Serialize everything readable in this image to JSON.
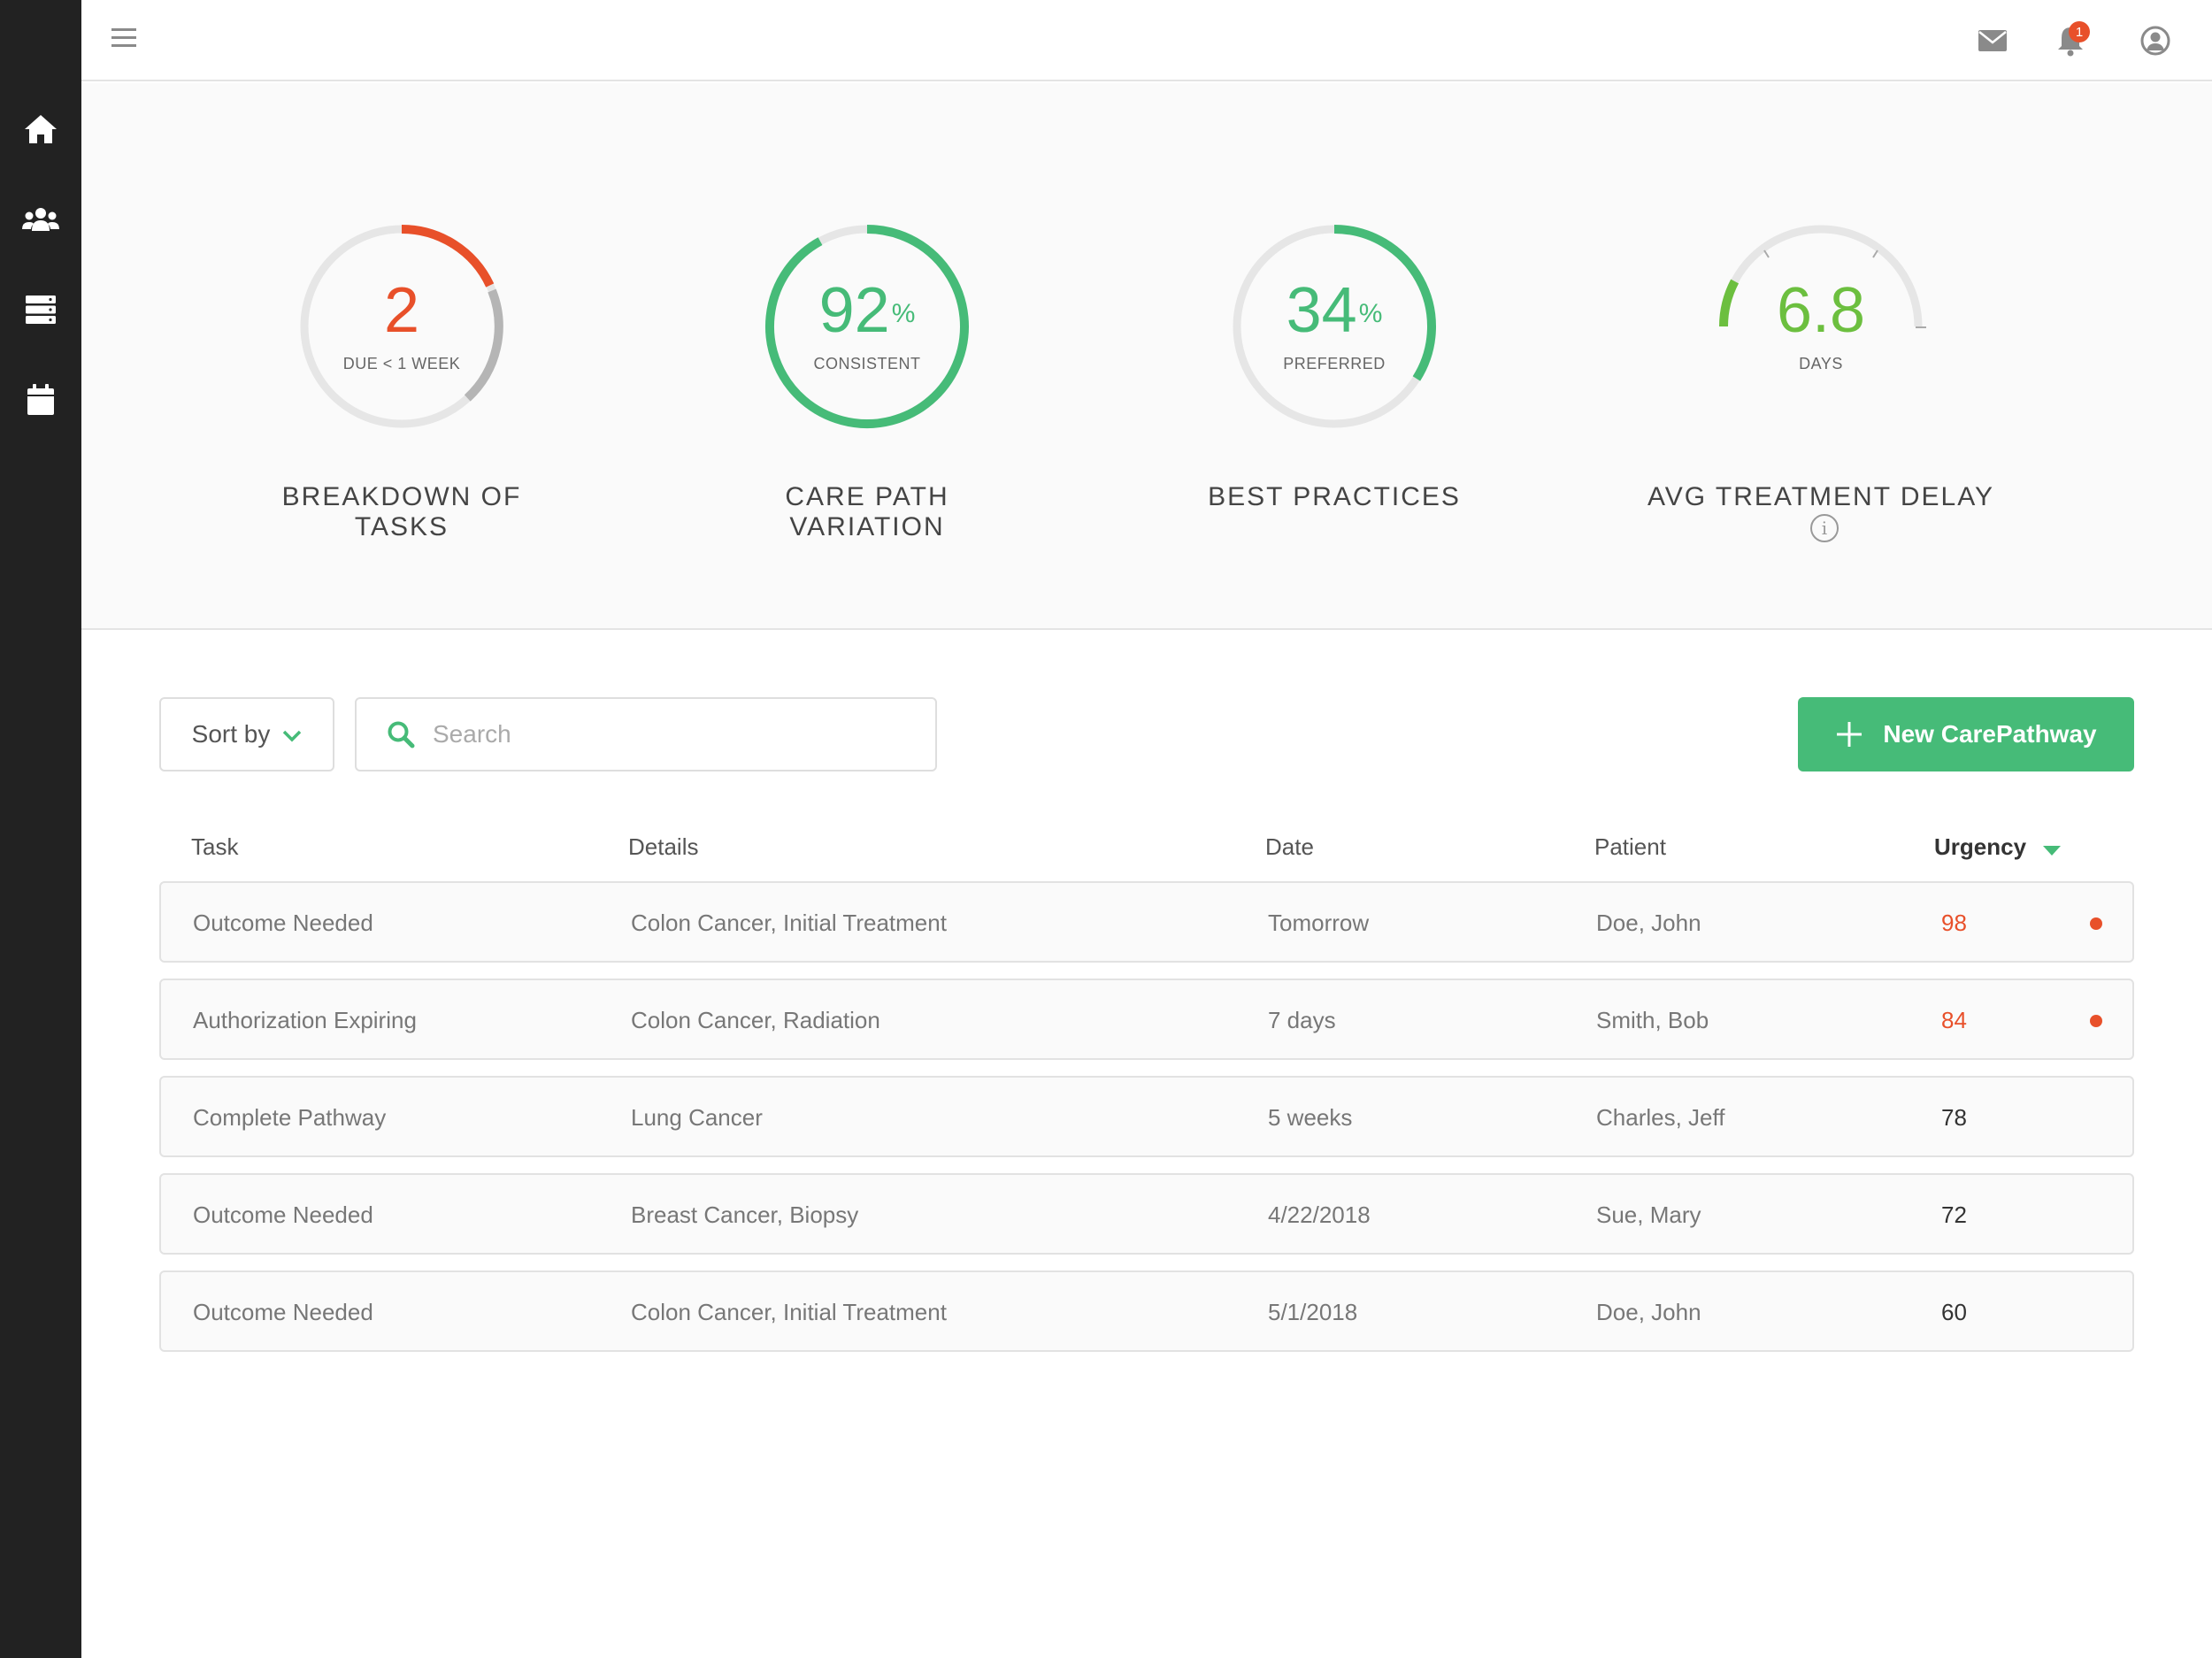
{
  "sidebar": {
    "items": [
      {
        "icon": "home-icon"
      },
      {
        "icon": "users-icon"
      },
      {
        "icon": "server-icon"
      },
      {
        "icon": "calendar-icon"
      }
    ]
  },
  "topbar": {
    "menu_icon": "menu-icon",
    "notification_count": "1",
    "icons": [
      "mail-icon",
      "bell-icon",
      "user-icon"
    ]
  },
  "metrics": [
    {
      "value": "2",
      "unit": "",
      "sub": "DUE < 1 WEEK",
      "title": "BREAKDOWN OF TASKS",
      "color": "#e8502a"
    },
    {
      "value": "92",
      "unit": "%",
      "sub": "CONSISTENT",
      "title": "CARE PATH VARIATION",
      "color": "#46bb78",
      "fraction": 0.92
    },
    {
      "value": "34",
      "unit": "%",
      "sub": "PREFERRED",
      "title": "BEST PRACTICES",
      "color": "#46bb78",
      "fraction": 0.34
    },
    {
      "value": "6.8",
      "unit": "",
      "sub": "DAYS",
      "title": "AVG TREATMENT DELAY",
      "color": "#6cbf3f",
      "info": "i"
    }
  ],
  "controls": {
    "sort_label": "Sort by",
    "search_placeholder": "Search",
    "new_button_label": "New CarePathway"
  },
  "table": {
    "columns": [
      "Task",
      "Details",
      "Date",
      "Patient",
      "Urgency"
    ],
    "rows": [
      {
        "task": "Outcome Needed",
        "details": "Colon Cancer, Initial Treatment",
        "date": "Tomorrow",
        "patient": "Doe, John",
        "urgency": "98",
        "flag": true
      },
      {
        "task": "Authorization Expiring",
        "details": "Colon Cancer, Radiation",
        "date": "7 days",
        "patient": "Smith, Bob",
        "urgency": "84",
        "flag": true
      },
      {
        "task": "Complete Pathway",
        "details": "Lung Cancer",
        "date": "5 weeks",
        "patient": "Charles, Jeff",
        "urgency": "78",
        "flag": false
      },
      {
        "task": "Outcome Needed",
        "details": "Breast Cancer, Biopsy",
        "date": "4/22/2018",
        "patient": "Sue, Mary",
        "urgency": "72",
        "flag": false
      },
      {
        "task": "Outcome Needed",
        "details": "Colon Cancer, Initial Treatment",
        "date": "5/1/2018",
        "patient": "Doe, John",
        "urgency": "60",
        "flag": false
      }
    ]
  },
  "colors": {
    "accent": "#46bb78",
    "alert": "#e8502a",
    "sidebar": "#222222"
  }
}
